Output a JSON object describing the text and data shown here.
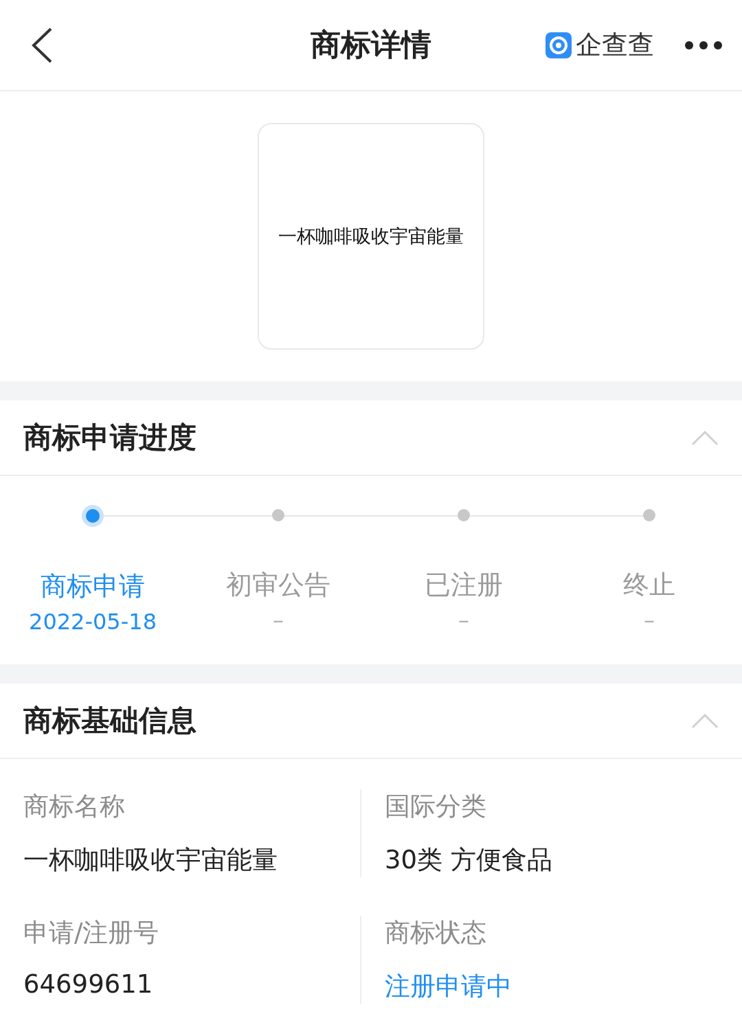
{
  "header": {
    "title": "商标详情",
    "brand": "企查查"
  },
  "trademark_image": {
    "text": "一杯咖啡吸收宇宙能量"
  },
  "progress": {
    "title": "商标申请进度",
    "expanded": true,
    "steps": [
      {
        "label": "商标申请",
        "date": "2022-05-18",
        "selected": true
      },
      {
        "label": "初审公告",
        "date": "–",
        "selected": false
      },
      {
        "label": "已注册",
        "date": "–",
        "selected": false
      },
      {
        "label": "终止",
        "date": "–",
        "selected": false
      }
    ]
  },
  "basic_info": {
    "title": "商标基础信息",
    "expanded": true,
    "fields": [
      {
        "label": "商标名称",
        "value": "一杯咖啡吸收宇宙能量",
        "kind": "plain"
      },
      {
        "label": "国际分类",
        "value": "30类 方便食品",
        "kind": "plain"
      },
      {
        "label": "申请/注册号",
        "value": "64699611",
        "kind": "plain"
      },
      {
        "label": "商标状态",
        "value": "注册申请中",
        "kind": "status"
      }
    ]
  }
}
